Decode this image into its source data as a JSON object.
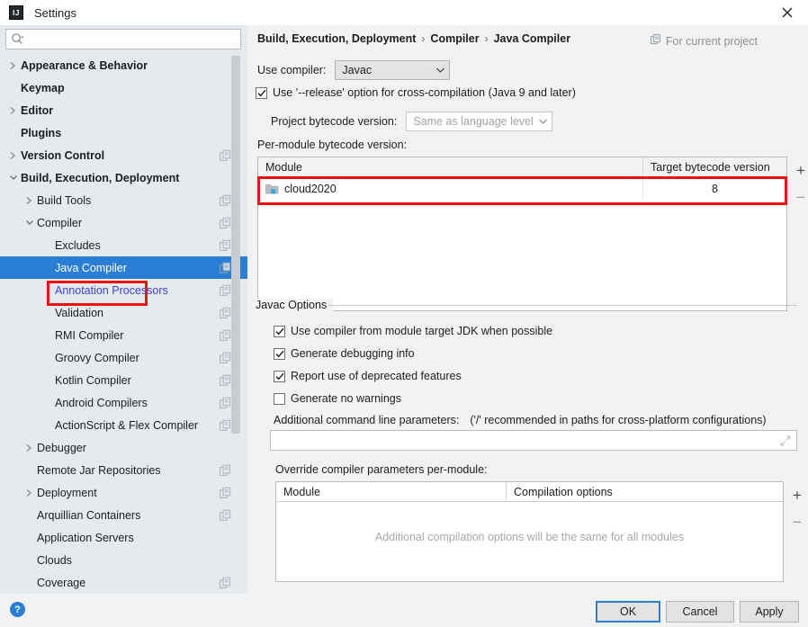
{
  "window": {
    "title": "Settings",
    "logo_text": "IJ",
    "close_label": "×"
  },
  "sidebar": {
    "search": {
      "placeholder": "",
      "value": "",
      "icon": "search-icon"
    },
    "items": [
      {
        "label": "Appearance & Behavior",
        "level": 0,
        "bold": true,
        "arrow": "collapsed",
        "config_icon": false,
        "selected": false,
        "link": false
      },
      {
        "label": "Keymap",
        "level": 0,
        "bold": true,
        "arrow": "none",
        "config_icon": false,
        "selected": false,
        "link": false
      },
      {
        "label": "Editor",
        "level": 0,
        "bold": true,
        "arrow": "collapsed",
        "config_icon": false,
        "selected": false,
        "link": false
      },
      {
        "label": "Plugins",
        "level": 0,
        "bold": true,
        "arrow": "none",
        "config_icon": false,
        "selected": false,
        "link": false
      },
      {
        "label": "Version Control",
        "level": 0,
        "bold": true,
        "arrow": "collapsed",
        "config_icon": true,
        "selected": false,
        "link": false
      },
      {
        "label": "Build, Execution, Deployment",
        "level": 0,
        "bold": true,
        "arrow": "expanded",
        "config_icon": false,
        "selected": false,
        "link": false
      },
      {
        "label": "Build Tools",
        "level": 1,
        "bold": false,
        "arrow": "collapsed",
        "config_icon": true,
        "selected": false,
        "link": false
      },
      {
        "label": "Compiler",
        "level": 1,
        "bold": false,
        "arrow": "expanded",
        "config_icon": true,
        "selected": false,
        "link": false
      },
      {
        "label": "Excludes",
        "level": 2,
        "bold": false,
        "arrow": "none",
        "config_icon": true,
        "selected": false,
        "link": false
      },
      {
        "label": "Java Compiler",
        "level": 2,
        "bold": false,
        "arrow": "none",
        "config_icon": true,
        "selected": true,
        "link": false
      },
      {
        "label": "Annotation Processors",
        "level": 2,
        "bold": false,
        "arrow": "none",
        "config_icon": true,
        "selected": false,
        "link": true
      },
      {
        "label": "Validation",
        "level": 2,
        "bold": false,
        "arrow": "none",
        "config_icon": true,
        "selected": false,
        "link": false
      },
      {
        "label": "RMI Compiler",
        "level": 2,
        "bold": false,
        "arrow": "none",
        "config_icon": true,
        "selected": false,
        "link": false
      },
      {
        "label": "Groovy Compiler",
        "level": 2,
        "bold": false,
        "arrow": "none",
        "config_icon": true,
        "selected": false,
        "link": false
      },
      {
        "label": "Kotlin Compiler",
        "level": 2,
        "bold": false,
        "arrow": "none",
        "config_icon": true,
        "selected": false,
        "link": false
      },
      {
        "label": "Android Compilers",
        "level": 2,
        "bold": false,
        "arrow": "none",
        "config_icon": true,
        "selected": false,
        "link": false
      },
      {
        "label": "ActionScript & Flex Compiler",
        "level": 2,
        "bold": false,
        "arrow": "none",
        "config_icon": true,
        "selected": false,
        "link": false
      },
      {
        "label": "Debugger",
        "level": 1,
        "bold": false,
        "arrow": "collapsed",
        "config_icon": false,
        "selected": false,
        "link": false
      },
      {
        "label": "Remote Jar Repositories",
        "level": 1,
        "bold": false,
        "arrow": "none",
        "config_icon": true,
        "selected": false,
        "link": false
      },
      {
        "label": "Deployment",
        "level": 1,
        "bold": false,
        "arrow": "collapsed",
        "config_icon": true,
        "selected": false,
        "link": false
      },
      {
        "label": "Arquillian Containers",
        "level": 1,
        "bold": false,
        "arrow": "none",
        "config_icon": true,
        "selected": false,
        "link": false
      },
      {
        "label": "Application Servers",
        "level": 1,
        "bold": false,
        "arrow": "none",
        "config_icon": false,
        "selected": false,
        "link": false
      },
      {
        "label": "Clouds",
        "level": 1,
        "bold": false,
        "arrow": "none",
        "config_icon": false,
        "selected": false,
        "link": false
      },
      {
        "label": "Coverage",
        "level": 1,
        "bold": false,
        "arrow": "none",
        "config_icon": true,
        "selected": false,
        "link": false
      }
    ]
  },
  "main": {
    "breadcrumb": {
      "part1": "Build, Execution, Deployment",
      "sep1": "›",
      "part2": "Compiler",
      "sep2": "›",
      "part3": "Java Compiler"
    },
    "for_current_project": "For current project",
    "use_compiler_label": "Use compiler:",
    "use_compiler_value": "Javac",
    "release_option_label": "Use '--release' option for cross-compilation (Java 9 and later)",
    "release_option_checked": true,
    "project_bytecode_label": "Project bytecode version:",
    "project_bytecode_value": "Same as language level",
    "per_module_label": "Per-module bytecode version:",
    "module_table": {
      "columns": [
        "Module",
        "Target bytecode version"
      ],
      "rows": [
        {
          "module": "cloud2020",
          "target": "8"
        }
      ],
      "add_label": "+",
      "remove_label": "−"
    },
    "javac_options": {
      "group_title": "Javac Options",
      "checkboxes": [
        {
          "label": "Use compiler from module target JDK when possible",
          "checked": true
        },
        {
          "label": "Generate debugging info",
          "checked": true
        },
        {
          "label": "Report use of deprecated features",
          "checked": true
        },
        {
          "label": "Generate no warnings",
          "checked": false
        }
      ],
      "additional_params_label": "Additional command line parameters:",
      "additional_params_hint": "('/' recommended in paths for cross-platform configurations)",
      "additional_params_value": ""
    },
    "override_section": {
      "label": "Override compiler parameters per-module:",
      "columns": [
        "Module",
        "Compilation options"
      ],
      "empty_message": "Additional compilation options will be the same for all modules",
      "add_label": "+",
      "remove_label": "−"
    }
  },
  "footer": {
    "help_label": "?",
    "ok_label": "OK",
    "cancel_label": "Cancel",
    "apply_label": "Apply"
  },
  "colors": {
    "accent": "#2a7fd4",
    "highlight_red": "#ee1111",
    "sidebar_bg": "#e5eaef",
    "panel_bg": "#f2f2f2",
    "link": "#3c42d6"
  }
}
